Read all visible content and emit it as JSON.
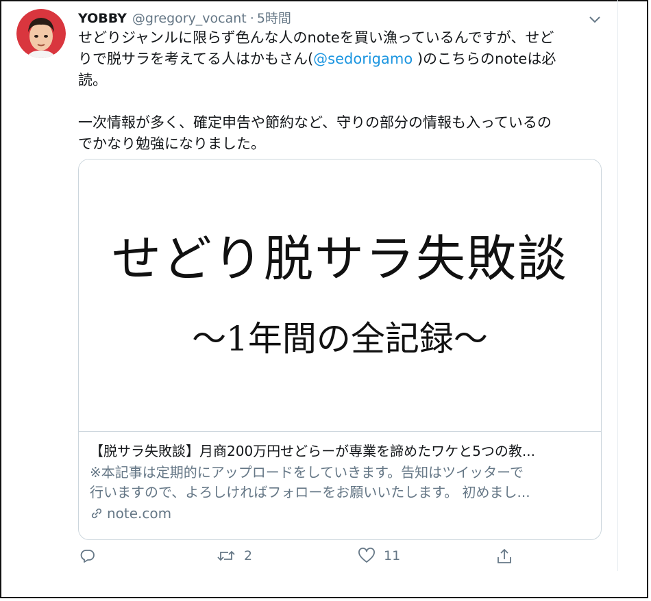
{
  "tweet": {
    "author_name": "YOBBY",
    "handle": "@gregory_vocant",
    "separator": "·",
    "time": "5時間",
    "text_line1": "せどりジャンルに限らず色んな人のnoteを買い漁っているんですが、せど",
    "text_line2_pre": "りで脱サラを考えてる人はかもさん(",
    "mention": "@sedorigamo",
    "text_line2_post": " )のこちらのnoteは必",
    "text_line3": "読。",
    "text_para2_line1": "一次情報が多く、確定申告や節約など、守りの部分の情報も入っているの",
    "text_para2_line2": "でかなり勉強になりました。"
  },
  "card": {
    "image_title": "せどり脱サラ失敗談",
    "image_subtitle": "〜1年間の全記録〜",
    "title": "【脱サラ失敗談】月商200万円せどらーが専業を諦めたワケと5つの教...",
    "desc_line1": "※本記事は定期的にアップロードをしていきます。告知はツイッターで",
    "desc_line2": "行いますので、よろしければフォローをお願いいたします。 初めまし...",
    "domain": "note.com"
  },
  "actions": {
    "reply_count": "",
    "retweet_count": "2",
    "like_count": "11"
  },
  "icons": {
    "reply": "reply-icon",
    "retweet": "retweet-icon",
    "like": "heart-icon",
    "share": "share-icon",
    "link": "link-icon",
    "caret": "chevron-down-icon"
  },
  "colors": {
    "link": "#1b95e0",
    "secondary_text": "#657786",
    "primary_text": "#14171a",
    "border": "#ccd6dd"
  }
}
